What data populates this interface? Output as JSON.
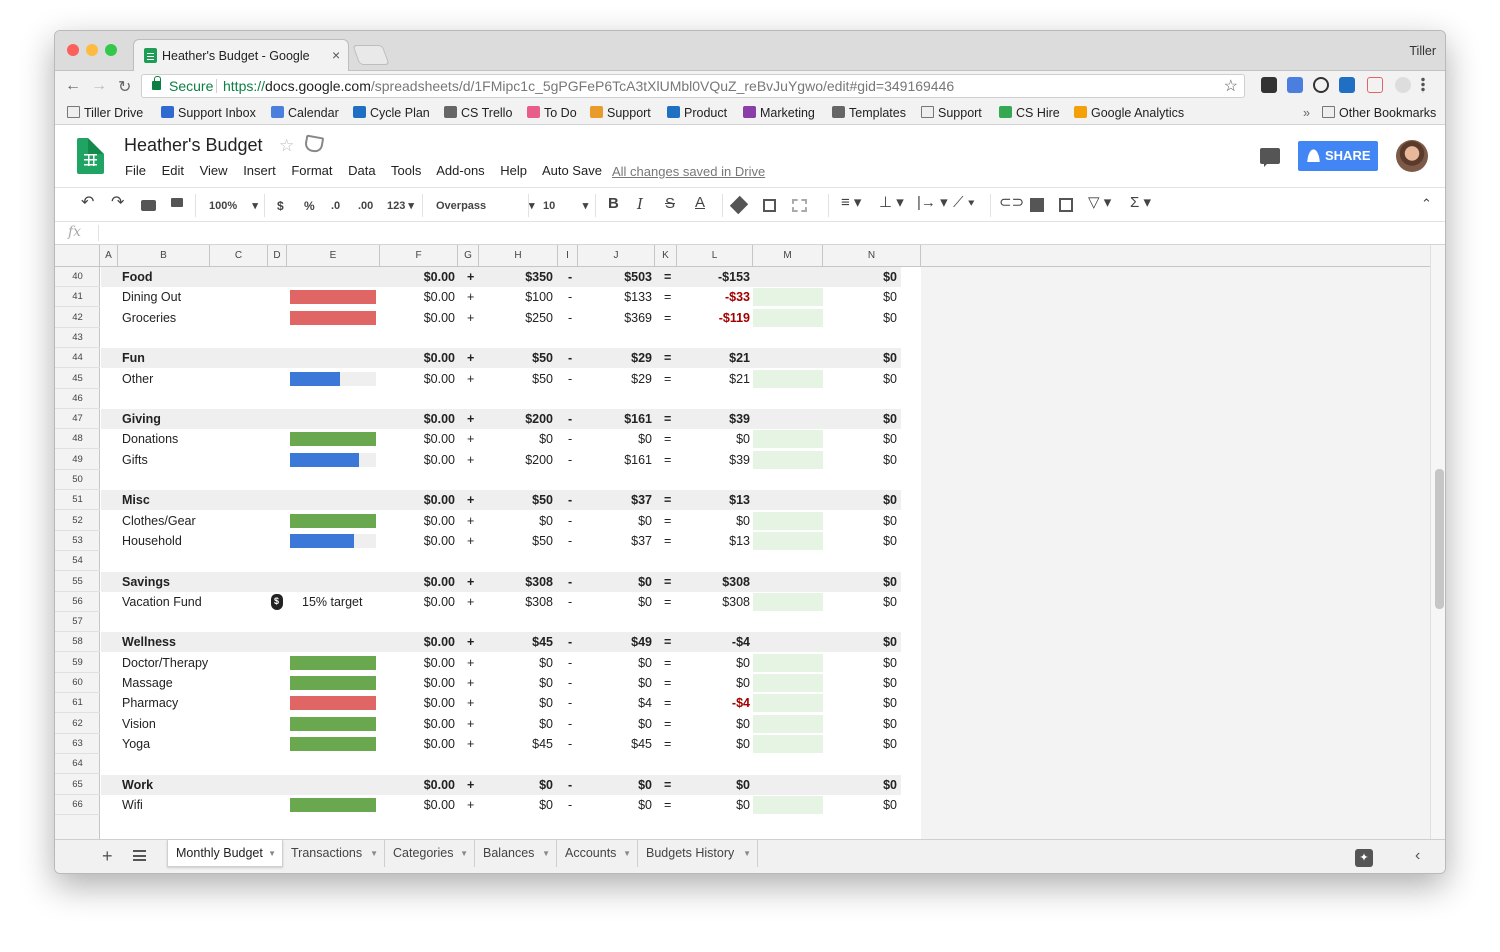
{
  "browser": {
    "tab_title": "Heather's Budget - Google She",
    "tab_close": "×",
    "profile_name": "Tiller",
    "secure_label": "Secure",
    "url_scheme": "https://",
    "url_host": "docs.google.com",
    "url_path": "/spreadsheets/d/1FMipc1c_5gPGFeP6TcA3tXlUMbl0VQuZ_reBvJuYgwo/edit#gid=349169446",
    "bookmarks": [
      {
        "label": "Tiller Drive",
        "icon": "folder-icon",
        "color": "#eeeeee"
      },
      {
        "label": "Support Inbox",
        "icon": "gmail-icon",
        "color": "#2f6ad0"
      },
      {
        "label": "Calendar",
        "icon": "calendar-icon",
        "color": "#4a7fe0"
      },
      {
        "label": "Cycle Plan",
        "icon": "trello-icon",
        "color": "#1f6fc3"
      },
      {
        "label": "CS Trello",
        "icon": "trello-icon",
        "color": "#666666"
      },
      {
        "label": "To Do",
        "icon": "todo-icon",
        "color": "#e85d8a"
      },
      {
        "label": "Support",
        "icon": "trello-icon",
        "color": "#e89a2a"
      },
      {
        "label": "Product",
        "icon": "trello-icon",
        "color": "#1f6fc3"
      },
      {
        "label": "Marketing",
        "icon": "trello-icon",
        "color": "#8a3ea7"
      },
      {
        "label": "Templates",
        "icon": "trello-icon",
        "color": "#666666"
      },
      {
        "label": "Support",
        "icon": "folder-icon",
        "color": "#eeeeee"
      },
      {
        "label": "CS Hire",
        "icon": "drive-icon",
        "color": "#34a853"
      },
      {
        "label": "Google Analytics",
        "icon": "analytics-icon",
        "color": "#f4a00b"
      }
    ],
    "bookmarks_more": "»",
    "other_bookmarks": "Other Bookmarks"
  },
  "doc": {
    "title": "Heather's Budget",
    "menus": [
      "File",
      "Edit",
      "View",
      "Insert",
      "Format",
      "Data",
      "Tools",
      "Add-ons",
      "Help",
      "Auto Save"
    ],
    "saved_status": "All changes saved in Drive",
    "share_label": "SHARE",
    "accent": "#4285f4"
  },
  "toolbar": {
    "zoom": "100%",
    "currency": "$",
    "percent": "%",
    "dec_decrease": ".0",
    "dec_increase": ".00",
    "more_formats": "123",
    "font": "Overpass",
    "font_size": "10",
    "bold": "B",
    "italic": "I",
    "strike": "S",
    "text_color": "A",
    "sum": "Σ"
  },
  "formula_bar": {
    "fx": "fx"
  },
  "grid": {
    "columns": [
      "A",
      "B",
      "C",
      "D",
      "E",
      "F",
      "G",
      "H",
      "I",
      "J",
      "K",
      "L",
      "M",
      "N"
    ],
    "rows": [
      {
        "n": "40",
        "type": "cat",
        "name": "Food",
        "f": "$0.00",
        "g": "+",
        "h": "$350",
        "i": "-",
        "j": "$503",
        "k": "=",
        "l": "-$153",
        "n_val": "$0"
      },
      {
        "n": "41",
        "type": "item",
        "name": "Dining Out",
        "bar": "red",
        "fill": 1.0,
        "f": "$0.00",
        "g": "+",
        "h": "$100",
        "i": "-",
        "j": "$133",
        "k": "=",
        "l": "-$33",
        "neg": true,
        "green": true,
        "n_val": "$0"
      },
      {
        "n": "42",
        "type": "item",
        "name": "Groceries",
        "bar": "red",
        "fill": 1.0,
        "f": "$0.00",
        "g": "+",
        "h": "$250",
        "i": "-",
        "j": "$369",
        "k": "=",
        "l": "-$119",
        "neg": true,
        "green": true,
        "n_val": "$0"
      },
      {
        "n": "43",
        "type": "blank"
      },
      {
        "n": "44",
        "type": "cat",
        "name": "Fun",
        "f": "$0.00",
        "g": "+",
        "h": "$50",
        "i": "-",
        "j": "$29",
        "k": "=",
        "l": "$21",
        "n_val": "$0"
      },
      {
        "n": "45",
        "type": "item",
        "name": "Other",
        "bar": "blue",
        "fill": 0.58,
        "f": "$0.00",
        "g": "+",
        "h": "$50",
        "i": "-",
        "j": "$29",
        "k": "=",
        "l": "$21",
        "green": true,
        "n_val": "$0"
      },
      {
        "n": "46",
        "type": "blank"
      },
      {
        "n": "47",
        "type": "cat",
        "name": "Giving",
        "f": "$0.00",
        "g": "+",
        "h": "$200",
        "i": "-",
        "j": "$161",
        "k": "=",
        "l": "$39",
        "n_val": "$0"
      },
      {
        "n": "48",
        "type": "item",
        "name": "Donations",
        "bar": "green",
        "fill": 1.0,
        "f": "$0.00",
        "g": "+",
        "h": "$0",
        "i": "-",
        "j": "$0",
        "k": "=",
        "l": "$0",
        "green": true,
        "n_val": "$0"
      },
      {
        "n": "49",
        "type": "item",
        "name": "Gifts",
        "bar": "blue",
        "fill": 0.8,
        "f": "$0.00",
        "g": "+",
        "h": "$200",
        "i": "-",
        "j": "$161",
        "k": "=",
        "l": "$39",
        "green": true,
        "n_val": "$0"
      },
      {
        "n": "50",
        "type": "blank"
      },
      {
        "n": "51",
        "type": "cat",
        "name": "Misc",
        "f": "$0.00",
        "g": "+",
        "h": "$50",
        "i": "-",
        "j": "$37",
        "k": "=",
        "l": "$13",
        "n_val": "$0"
      },
      {
        "n": "52",
        "type": "item",
        "name": "Clothes/Gear",
        "bar": "green",
        "fill": 1.0,
        "f": "$0.00",
        "g": "+",
        "h": "$0",
        "i": "-",
        "j": "$0",
        "k": "=",
        "l": "$0",
        "green": true,
        "n_val": "$0"
      },
      {
        "n": "53",
        "type": "item",
        "name": "Household",
        "bar": "blue",
        "fill": 0.74,
        "f": "$0.00",
        "g": "+",
        "h": "$50",
        "i": "-",
        "j": "$37",
        "k": "=",
        "l": "$13",
        "green": true,
        "n_val": "$0"
      },
      {
        "n": "54",
        "type": "blank"
      },
      {
        "n": "55",
        "type": "cat",
        "name": "Savings",
        "f": "$0.00",
        "g": "+",
        "h": "$308",
        "i": "-",
        "j": "$0",
        "k": "=",
        "l": "$308",
        "n_val": "$0"
      },
      {
        "n": "56",
        "type": "item",
        "name": "Vacation Fund",
        "target": "15% target",
        "f": "$0.00",
        "g": "+",
        "h": "$308",
        "i": "-",
        "j": "$0",
        "k": "=",
        "l": "$308",
        "green": true,
        "n_val": "$0"
      },
      {
        "n": "57",
        "type": "blank"
      },
      {
        "n": "58",
        "type": "cat",
        "name": "Wellness",
        "f": "$0.00",
        "g": "+",
        "h": "$45",
        "i": "-",
        "j": "$49",
        "k": "=",
        "l": "-$4",
        "n_val": "$0"
      },
      {
        "n": "59",
        "type": "item",
        "name": "Doctor/Therapy",
        "bar": "green",
        "fill": 1.0,
        "f": "$0.00",
        "g": "+",
        "h": "$0",
        "i": "-",
        "j": "$0",
        "k": "=",
        "l": "$0",
        "green": true,
        "n_val": "$0"
      },
      {
        "n": "60",
        "type": "item",
        "name": "Massage",
        "bar": "green",
        "fill": 1.0,
        "f": "$0.00",
        "g": "+",
        "h": "$0",
        "i": "-",
        "j": "$0",
        "k": "=",
        "l": "$0",
        "green": true,
        "n_val": "$0"
      },
      {
        "n": "61",
        "type": "item",
        "name": "Pharmacy",
        "bar": "red",
        "fill": 1.0,
        "f": "$0.00",
        "g": "+",
        "h": "$0",
        "i": "-",
        "j": "$4",
        "k": "=",
        "l": "-$4",
        "neg": true,
        "green": true,
        "n_val": "$0"
      },
      {
        "n": "62",
        "type": "item",
        "name": "Vision",
        "bar": "green",
        "fill": 1.0,
        "f": "$0.00",
        "g": "+",
        "h": "$0",
        "i": "-",
        "j": "$0",
        "k": "=",
        "l": "$0",
        "green": true,
        "n_val": "$0"
      },
      {
        "n": "63",
        "type": "item",
        "name": "Yoga",
        "bar": "green",
        "fill": 1.0,
        "f": "$0.00",
        "g": "+",
        "h": "$45",
        "i": "-",
        "j": "$45",
        "k": "=",
        "l": "$0",
        "green": true,
        "n_val": "$0"
      },
      {
        "n": "64",
        "type": "blank"
      },
      {
        "n": "65",
        "type": "cat",
        "name": "Work",
        "f": "$0.00",
        "g": "+",
        "h": "$0",
        "i": "-",
        "j": "$0",
        "k": "=",
        "l": "$0",
        "n_val": "$0"
      },
      {
        "n": "66",
        "type": "item",
        "name": "Wifi",
        "bar": "green",
        "fill": 1.0,
        "f": "$0.00",
        "g": "+",
        "h": "$0",
        "i": "-",
        "j": "$0",
        "k": "=",
        "l": "$0",
        "green": true,
        "n_val": "$0"
      }
    ],
    "bar_colors": {
      "red": "#e06666",
      "green": "#6aa84f",
      "blue": "#3c78d8"
    },
    "negative_color": "#a30000"
  },
  "sheets": {
    "tabs": [
      {
        "label": "Monthly Budget",
        "active": true
      },
      {
        "label": "Transactions",
        "active": false
      },
      {
        "label": "Categories",
        "active": false
      },
      {
        "label": "Balances",
        "active": false
      },
      {
        "label": "Accounts",
        "active": false
      },
      {
        "label": "Budgets History",
        "active": false
      }
    ],
    "add_label": "+"
  }
}
